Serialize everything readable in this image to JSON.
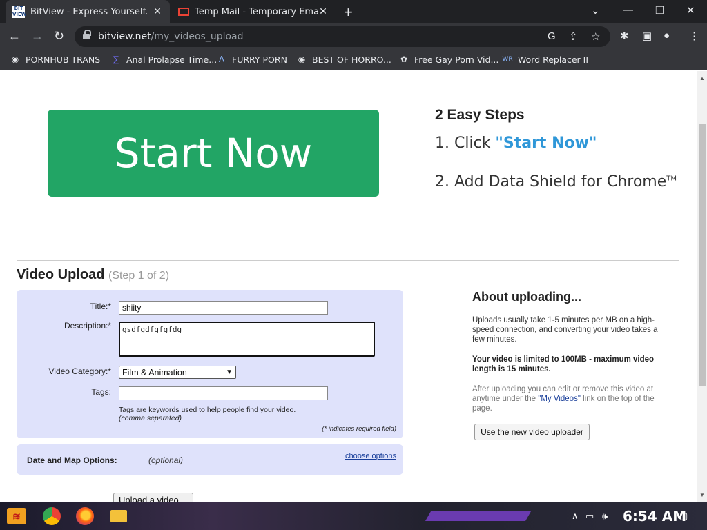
{
  "browser": {
    "tabs": [
      {
        "title": "BitView - Express Yourself.",
        "favicon": "bitview-icon"
      },
      {
        "title": "Temp Mail - Temporary Email",
        "favicon": "gmail-icon"
      }
    ],
    "url_domain": "bitview.net",
    "url_path": "/my_videos_upload",
    "bookmarks": [
      {
        "label": "PORNHUB TRANS",
        "icon": "globe-icon"
      },
      {
        "label": "Anal Prolapse Time...",
        "icon": "bookmark-icon"
      },
      {
        "label": "FURRY PORN",
        "icon": "lambda-icon"
      },
      {
        "label": "BEST OF HORRO...",
        "icon": "globe-icon"
      },
      {
        "label": "Free Gay Porn Vid...",
        "icon": "site-icon"
      },
      {
        "label": "Word Replacer II",
        "icon": "wr-icon"
      }
    ]
  },
  "ad": {
    "button_label": "Start Now",
    "title": "2 Easy Steps",
    "step1_prefix": "1. Click ",
    "step1_highlight": "\"Start Now\"",
    "step2_text": "2. Add Data Shield for Chrome",
    "step2_tm": "TM",
    "highlight_color": "#2f97d8",
    "button_color": "#22a565"
  },
  "upload": {
    "heading": "Video Upload",
    "step": "(Step 1 of 2)",
    "title_label": "Title:*",
    "title_value": "shiity",
    "description_label": "Description:*",
    "description_value": "gsdfgdfgfgfdg",
    "category_label": "Video Category:*",
    "category_value": "Film & Animation",
    "tags_label": "Tags:",
    "tags_value": "",
    "tags_hint": "Tags are keywords used to help people find your video.",
    "tags_hint2": "(comma separated)",
    "required_note": "(* indicates required field)",
    "date_map_label": "Date and Map Options:",
    "date_map_optional": "(optional)",
    "choose_options": "choose options",
    "upload_button": "Upload a video..."
  },
  "about": {
    "title": "About uploading...",
    "p1": "Uploads usually take 1-5 minutes per MB on a high-speed connection, and converting your video takes a few minutes.",
    "p2": "Your video is limited to 100MB - maximum video length is 15 minutes.",
    "p3_prefix": "After uploading you can edit or remove this video at anytime under the ",
    "p3_link": "\"My Videos\"",
    "p3_suffix": " link on the top of the page.",
    "new_uploader_button": "Use the new video uploader"
  },
  "taskbar": {
    "clock": "6:54 AM"
  }
}
